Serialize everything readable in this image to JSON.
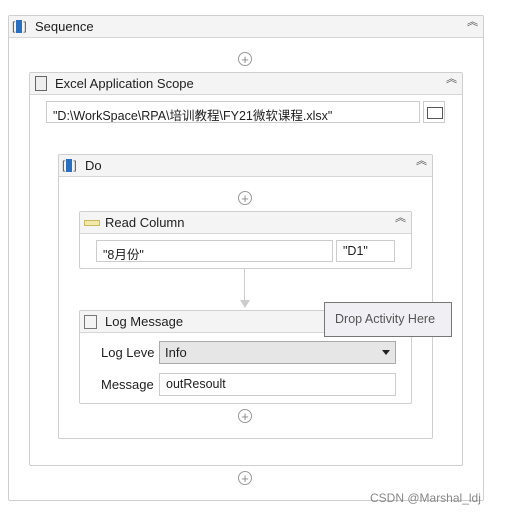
{
  "sequence": {
    "title": "Sequence"
  },
  "excel_scope": {
    "title": "Excel Application Scope",
    "path": "\"D:\\WorkSpace\\RPA\\培训教程\\FY21微软课程.xlsx\""
  },
  "do": {
    "title": "Do"
  },
  "read_column": {
    "title": "Read Column",
    "sheet": "\"8月份\"",
    "cell": "\"D1\""
  },
  "log_message": {
    "title": "Log Message",
    "level_label": "Log Leve",
    "level_value": "Info",
    "message_label": "Message",
    "message_value": "outResoult"
  },
  "tooltip": "Drop Activity Here",
  "watermark": "CSDN @Marshal_ldj",
  "icons": {
    "collapse": "double-chevron-up",
    "add": "plus-circle",
    "browse": "folder"
  }
}
